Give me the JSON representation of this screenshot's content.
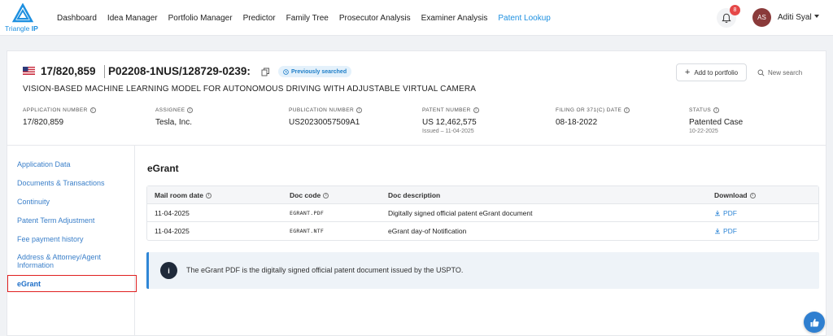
{
  "brand": {
    "name_light": "Triangle ",
    "name_bold": "IP"
  },
  "nav": {
    "items": [
      {
        "label": "Dashboard"
      },
      {
        "label": "Idea Manager"
      },
      {
        "label": "Portfolio Manager"
      },
      {
        "label": "Predictor"
      },
      {
        "label": "Family Tree"
      },
      {
        "label": "Prosecutor Analysis"
      },
      {
        "label": "Examiner Analysis"
      },
      {
        "label": "Patent Lookup"
      }
    ],
    "active": "Patent Lookup",
    "notifications": "8",
    "user_initials": "AS",
    "user_name": "Aditi Syal"
  },
  "header": {
    "application_number": "17/820,859",
    "docket": "P02208-1NUS/128729-0239:",
    "badge": "Previously searched",
    "add_to_portfolio": "Add to portfolio",
    "new_search": "New search",
    "description": "VISION-BASED MACHINE LEARNING MODEL FOR AUTONOMOUS DRIVING WITH ADJUSTABLE VIRTUAL CAMERA",
    "fields": [
      {
        "label": "APPLICATION NUMBER",
        "value": "17/820,859",
        "sub": ""
      },
      {
        "label": "ASSIGNEE",
        "value": "Tesla, Inc.",
        "sub": ""
      },
      {
        "label": "PUBLICATION NUMBER",
        "value": "US20230057509A1",
        "sub": ""
      },
      {
        "label": "PATENT NUMBER",
        "value": "US 12,462,575",
        "sub": "Issued – 11-04-2025"
      },
      {
        "label": "FILING OR 371(C) DATE",
        "value": "08-18-2022",
        "sub": ""
      },
      {
        "label": "STATUS",
        "value": "Patented Case",
        "sub": "10-22-2025"
      }
    ]
  },
  "sidebar": {
    "items": [
      {
        "label": "Application Data"
      },
      {
        "label": "Documents & Transactions"
      },
      {
        "label": "Continuity"
      },
      {
        "label": "Patent Term Adjustment"
      },
      {
        "label": "Fee payment history"
      },
      {
        "label": "Address & Attorney/Agent",
        "label2": "Information"
      },
      {
        "label": "eGrant"
      }
    ],
    "active": "eGrant"
  },
  "egrant": {
    "title": "eGrant",
    "columns": [
      "Mail room date",
      "Doc code",
      "Doc description",
      "Download"
    ],
    "rows": [
      {
        "date": "11-04-2025",
        "code": "EGRANT.PDF",
        "description": "Digitally signed official patent eGrant document",
        "download": "PDF"
      },
      {
        "date": "11-04-2025",
        "code": "EGRANT.NTF",
        "description": "eGrant day-of Notification",
        "download": "PDF"
      }
    ],
    "notice": "The eGrant PDF is the digitally signed official patent document issued by the USPTO."
  },
  "colors": {
    "accent": "#1e90e0",
    "link": "#2f86d6",
    "highlight_border": "#e02020"
  },
  "icons": [
    "triangle-logo-icon",
    "bell-icon",
    "caret-down-icon",
    "us-flag-icon",
    "copy-icon",
    "clock-icon",
    "plus-icon",
    "search-icon",
    "info-icon",
    "download-icon",
    "help-icon"
  ]
}
